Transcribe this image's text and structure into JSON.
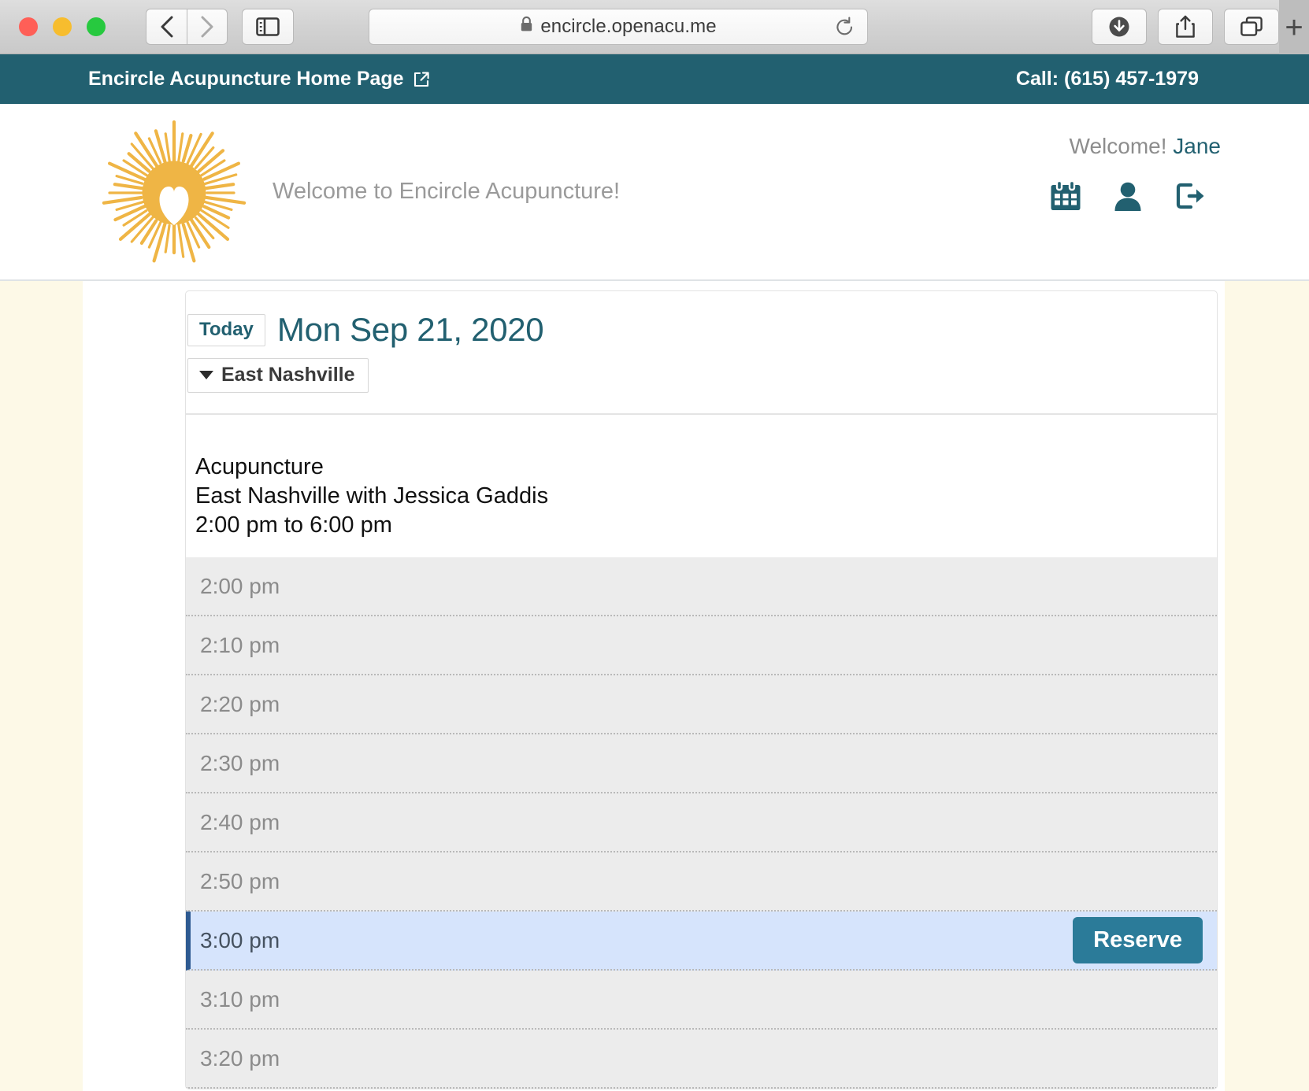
{
  "browser": {
    "url": "encircle.openacu.me",
    "back_label": "Back",
    "forward_label": "Forward",
    "sidebar_label": "Show Sidebar",
    "reload_label": "Reload",
    "downloads_label": "Downloads",
    "share_label": "Share",
    "tabs_label": "Tab Overview",
    "newtab_label": "+"
  },
  "topbar": {
    "home_link": "Encircle Acupuncture Home Page",
    "phone": "Call: (615) 457-1979"
  },
  "header": {
    "tagline": "Welcome to Encircle Acupuncture!",
    "welcome_prefix": "Welcome!",
    "user_name": "Jane",
    "logo_alt": "Encircle Acupuncture sunburst heart logo"
  },
  "schedule": {
    "today_label": "Today",
    "date": "Mon Sep 21, 2020",
    "location": "East Nashville",
    "appointment": {
      "service": "Acupuncture",
      "provider_line": "East Nashville with Jessica Gaddis",
      "hours": "2:00 pm to 6:00 pm"
    },
    "reserve_label": "Reserve",
    "slots": [
      {
        "time": "2:00 pm",
        "selected": false
      },
      {
        "time": "2:10 pm",
        "selected": false
      },
      {
        "time": "2:20 pm",
        "selected": false
      },
      {
        "time": "2:30 pm",
        "selected": false
      },
      {
        "time": "2:40 pm",
        "selected": false
      },
      {
        "time": "2:50 pm",
        "selected": false
      },
      {
        "time": "3:00 pm",
        "selected": true
      },
      {
        "time": "3:10 pm",
        "selected": false
      },
      {
        "time": "3:20 pm",
        "selected": false
      }
    ]
  },
  "colors": {
    "brand_teal": "#226070",
    "accent_gold": "#efb545",
    "page_cream": "#fdf9e7",
    "selected_row": "#d6e4fc",
    "reserve_button": "#2b7b99"
  }
}
